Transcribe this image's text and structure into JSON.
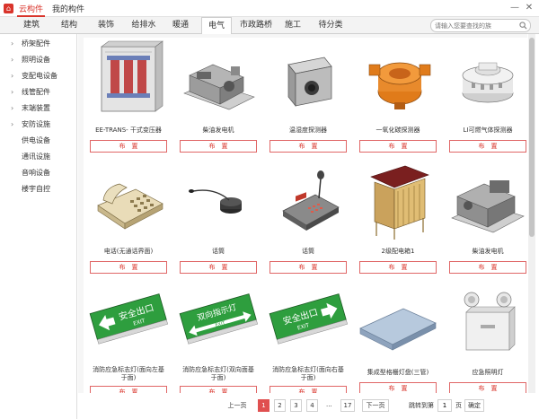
{
  "titlebar": {
    "tabs": [
      {
        "label": "云构件",
        "active": true
      },
      {
        "label": "我的构件",
        "active": false
      }
    ],
    "minimize": "—",
    "close": "✕"
  },
  "categories": [
    "建筑",
    "结构",
    "装饰",
    "给排水",
    "暖通",
    "电气",
    "市政路桥",
    "施工",
    "待分类"
  ],
  "active_category": "电气",
  "search": {
    "placeholder": "请输入您要查找的族"
  },
  "sidebar": {
    "items": [
      {
        "label": "桥架配件",
        "expandable": true
      },
      {
        "label": "照明设备",
        "expandable": true
      },
      {
        "label": "变配电设备",
        "expandable": true
      },
      {
        "label": "线管配件",
        "expandable": true
      },
      {
        "label": "末端装置",
        "expandable": true
      },
      {
        "label": "安防设施",
        "expandable": true
      },
      {
        "label": "供电设备",
        "expandable": false
      },
      {
        "label": "通讯设施",
        "expandable": false
      },
      {
        "label": "音响设备",
        "expandable": false
      },
      {
        "label": "楼宇自控",
        "expandable": false
      }
    ]
  },
  "place_label": "布　置",
  "cards": [
    {
      "name": "EE-TRANS- 干式变压器",
      "icon": "transformer-icon"
    },
    {
      "name": "柴油发电机",
      "icon": "generator-icon"
    },
    {
      "name": "温湿度探测器",
      "icon": "humidity-sensor-icon"
    },
    {
      "name": "一氧化碳探测器",
      "icon": "co-detector-icon"
    },
    {
      "name": "LI可燃气体探测器",
      "icon": "gas-detector-icon"
    },
    {
      "name": "电话(无通话界面)",
      "icon": "telephone-icon"
    },
    {
      "name": "话筒",
      "icon": "microphone-icon"
    },
    {
      "name": "话筒",
      "icon": "paging-console-icon"
    },
    {
      "name": "2级配电箱1",
      "icon": "distribution-box-icon"
    },
    {
      "name": "柴油发电机",
      "icon": "generator-icon"
    },
    {
      "name": "消防应急标志灯(面向左基于面)",
      "line1": "消防应急标志灯(面向左基",
      "line2": "于面)",
      "icon": "exit-sign-left-icon",
      "sign": "安全出口",
      "sign_sub": "EXIT"
    },
    {
      "name": "消防应急标志灯(双向面基于面)",
      "line1": "消防应急标志灯(双向面基",
      "line2": "于面)",
      "icon": "exit-sign-both-icon",
      "sign": "双向指示灯",
      "sign_sub": "EXIT"
    },
    {
      "name": "消防应急标志灯(面向右基于面)",
      "line1": "消防应急标志灯(面向右基",
      "line2": "于面)",
      "icon": "exit-sign-right-icon",
      "sign": "安全出口",
      "sign_sub": "EXIT"
    },
    {
      "name": "集成型格栅灯盘(三管)",
      "icon": "grille-lamp-icon"
    },
    {
      "name": "应急照明灯",
      "icon": "emergency-light-icon"
    }
  ],
  "pagination": {
    "prev": "上一页",
    "pages": [
      "1",
      "2",
      "3",
      "4",
      "...",
      "17"
    ],
    "current": "1",
    "next": "下一页",
    "jump_label": "跳转到第",
    "jump_value": "1",
    "page_unit": "页",
    "confirm": "确定"
  },
  "colors": {
    "accent": "#d9342b",
    "exit_green": "#2e9e3e",
    "orange": "#e07b1a"
  }
}
